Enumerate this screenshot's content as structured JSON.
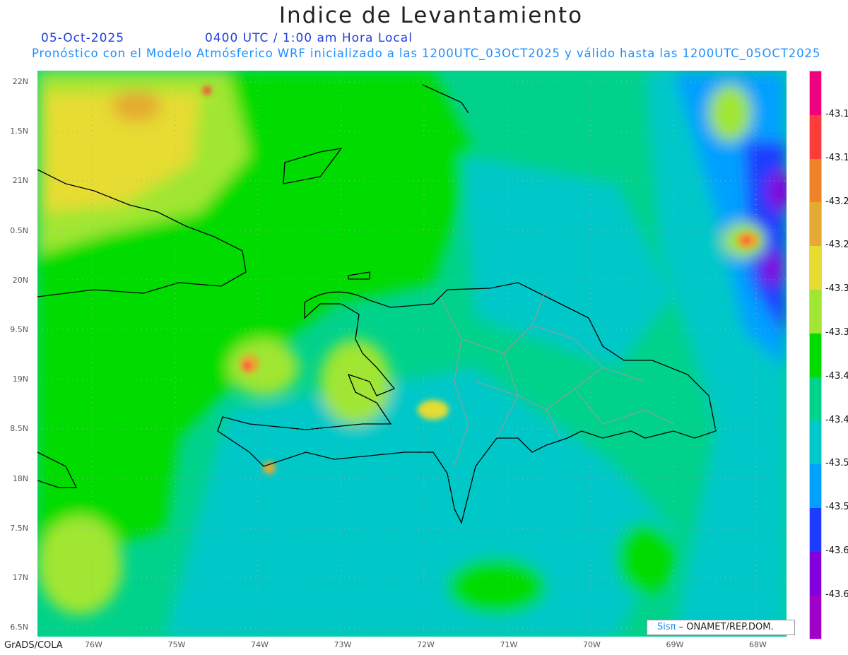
{
  "title": "Indice de Levantamiento",
  "date": "05-Oct-2025",
  "time": "0400 UTC / 1:00 am Hora Local",
  "subtitle": "Pronóstico con el Modelo Atmósferico WRF inicializado a las 1200UTC_03OCT2025 y válido hasta las  1200UTC_05OCT2025",
  "lat_labels": [
    "22N",
    "1.5N",
    "21N",
    "0.5N",
    "20N",
    "9.5N",
    "19N",
    "8.5N",
    "18N",
    "7.5N",
    "17N",
    "6.5N"
  ],
  "lon_labels": [
    "76W",
    "75W",
    "74W",
    "73W",
    "72W",
    "71W",
    "70W",
    "69W",
    "68W"
  ],
  "colorbar": {
    "colors": [
      "#f0007f",
      "#ff3c3c",
      "#f08228",
      "#e6aa32",
      "#e6dc32",
      "#a0e632",
      "#00dc00",
      "#00d28c",
      "#00c8c8",
      "#00a0ff",
      "#1e3cff",
      "#8200dc",
      "#a000c8"
    ],
    "labels": [
      "-43.1",
      "-43.1",
      "-43.2",
      "-43.2",
      "-43.3",
      "-43.3",
      "-43.4",
      "-43.4",
      "-43.5",
      "-43.5",
      "-43.6",
      "-43.6"
    ]
  },
  "credit": {
    "brand": "Sisπ",
    "text": "– ONAMET/REP.DOM."
  },
  "footer": "GrADS/COLA"
}
